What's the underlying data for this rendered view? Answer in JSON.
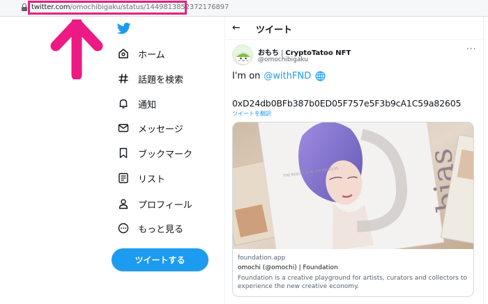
{
  "browser": {
    "url_domain": "twitter.com",
    "url_path": "/omochibigaku/status/1449813852372176897"
  },
  "sidebar": {
    "logo": "twitter-bird-icon",
    "items": [
      {
        "label": "ホーム",
        "icon": "home-icon"
      },
      {
        "label": "話題を検索",
        "icon": "hashtag-icon"
      },
      {
        "label": "通知",
        "icon": "bell-icon"
      },
      {
        "label": "メッセージ",
        "icon": "mail-icon"
      },
      {
        "label": "ブックマーク",
        "icon": "bookmark-icon"
      },
      {
        "label": "リスト",
        "icon": "list-icon"
      },
      {
        "label": "プロフィール",
        "icon": "profile-icon"
      },
      {
        "label": "もっと見る",
        "icon": "more-circle-icon"
      }
    ],
    "tweet_button": "ツイートする"
  },
  "header": {
    "back": "←",
    "title": "ツイート"
  },
  "tweet": {
    "display_name": "おもち",
    "name_separator": "|",
    "name_suffix": "CryptoTatoo NFT",
    "handle": "@omochibigaku",
    "more": "···",
    "text_line1": "I'm on",
    "mention": "@withFND",
    "text_line2": "0xD24db0BFb387b0ED05F757e5F3b9cA1C59a82605",
    "translate": "ツイートを翻訳",
    "card": {
      "domain": "foundation.app",
      "title": "omochi (@omochi) | Foundation",
      "description": "Foundation is a creative playground for artists, curators and collectors to experience the new creative economy.",
      "image_text": "bias"
    }
  },
  "colors": {
    "accent": "#1d9bf0",
    "highlight": "#e8207e"
  }
}
